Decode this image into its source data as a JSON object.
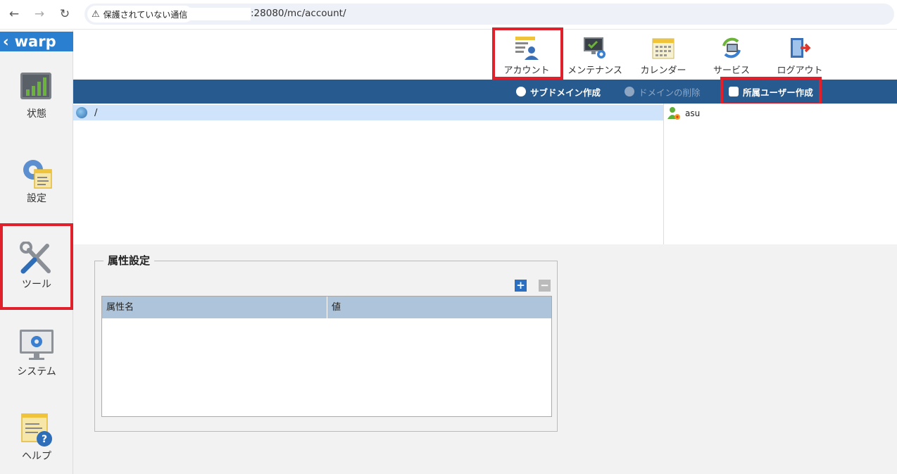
{
  "browser": {
    "security_label": "保護されていない通信",
    "url": ":28080/mc/account/"
  },
  "sidebar": {
    "logo": "warp",
    "items": [
      {
        "label": "状態",
        "icon": "status-chart-icon"
      },
      {
        "label": "設定",
        "icon": "settings-gear-icon"
      },
      {
        "label": "ツール",
        "icon": "tools-icon"
      },
      {
        "label": "システム",
        "icon": "system-monitor-icon"
      },
      {
        "label": "ヘルプ",
        "icon": "help-icon"
      }
    ]
  },
  "toolbar": {
    "items": [
      {
        "label": "アカウント",
        "icon": "account-icon"
      },
      {
        "label": "メンテナンス",
        "icon": "maintenance-icon"
      },
      {
        "label": "カレンダー",
        "icon": "calendar-icon"
      },
      {
        "label": "サービス",
        "icon": "service-icon"
      },
      {
        "label": "ログアウト",
        "icon": "logout-icon"
      }
    ]
  },
  "actions": {
    "create_subdomain": "サブドメイン作成",
    "delete_domain": "ドメインの削除",
    "create_user": "所属ユーザー作成"
  },
  "tree": {
    "root": "/"
  },
  "users": {
    "items": [
      "asu"
    ]
  },
  "attributes": {
    "title": "属性設定",
    "add": "+",
    "remove": "−",
    "columns": [
      "属性名",
      "値"
    ]
  },
  "colors": {
    "actionbar": "#275a8f",
    "highlight": "#e0202a",
    "logo": "#2a7fd0"
  }
}
